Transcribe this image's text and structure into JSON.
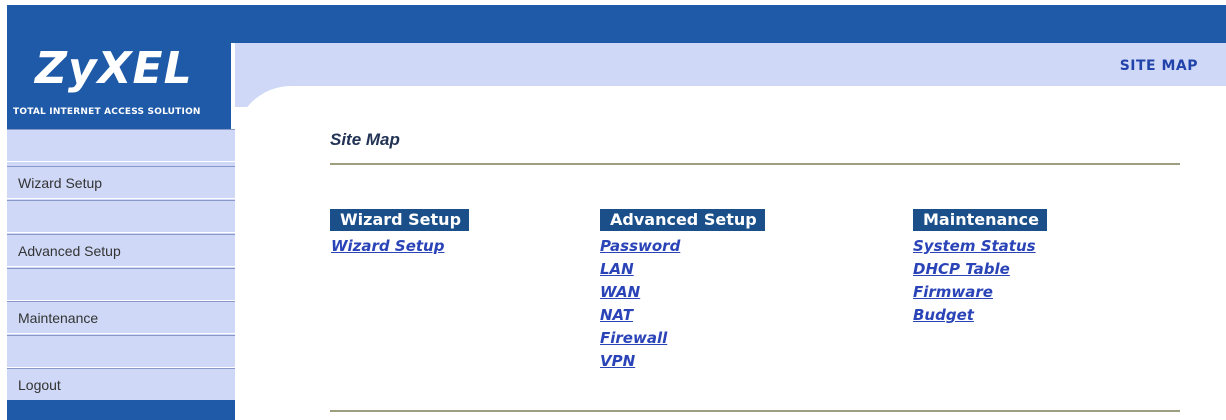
{
  "brand": {
    "logo": "ZyXEL",
    "tagline": "Total Internet Access Solution"
  },
  "header": {
    "title": "SITE MAP"
  },
  "sidebar": {
    "items": [
      {
        "label": "Wizard Setup"
      },
      {
        "label": "Advanced Setup"
      },
      {
        "label": "Maintenance"
      },
      {
        "label": "Logout"
      }
    ]
  },
  "main": {
    "heading": "Site Map",
    "sections": [
      {
        "title": "Wizard Setup",
        "links": [
          "Wizard Setup"
        ]
      },
      {
        "title": "Advanced Setup",
        "links": [
          "Password",
          "LAN",
          "WAN",
          "NAT",
          "Firewall",
          "VPN"
        ]
      },
      {
        "title": "Maintenance",
        "links": [
          "System Status",
          "DHCP Table",
          "Firmware",
          "Budget"
        ]
      }
    ]
  },
  "colors": {
    "brand_blue": "#1e5aa8",
    "panel_light": "#cfd9f7",
    "link_blue": "#2a44b8",
    "section_head": "#1a4f8a"
  }
}
